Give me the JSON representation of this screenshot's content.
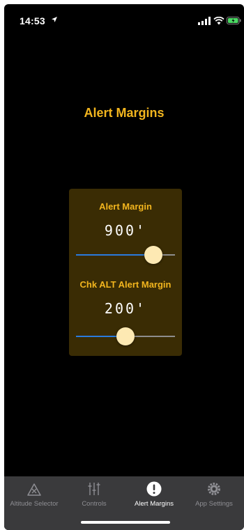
{
  "status_bar": {
    "time": "14:53"
  },
  "page": {
    "title": "Alert Margins"
  },
  "alert_margin": {
    "label": "Alert Margin",
    "value": "900'",
    "slider_fraction": 0.78
  },
  "chk_alt_alert_margin": {
    "label": "Chk ALT Alert Margin",
    "value": "200'",
    "slider_fraction": 0.5
  },
  "tab_bar": {
    "tabs": [
      {
        "label": "Altitude Selector",
        "icon": "altitude-selector-icon"
      },
      {
        "label": "Controls",
        "icon": "sliders-icon"
      },
      {
        "label": "Alert Margins",
        "icon": "alert-icon",
        "active": true
      },
      {
        "label": "App Settings",
        "icon": "gear-icon"
      }
    ]
  },
  "colors": {
    "accent": "#f2b51e",
    "panel": "#3a2c04",
    "slider_fill": "#2a7bdf",
    "thumb": "#fde9b3",
    "battery": "#4cd964"
  }
}
